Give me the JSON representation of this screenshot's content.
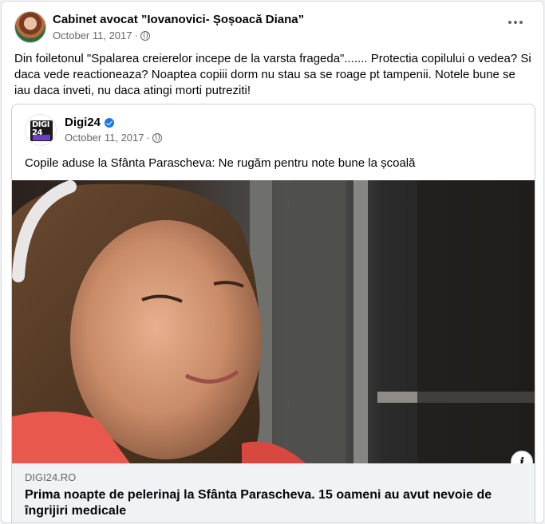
{
  "post": {
    "author": "Cabinet avocat ”Iovanovici- Șoșoacă Diana”",
    "timestamp": "October 11, 2017",
    "separator": "·",
    "privacy_icon": "globe-icon",
    "more_icon": "more-options-icon",
    "text": "Din foiletonul \"Spalarea creierelor incepe de la varsta frageda\"....... Protectia copilului o vedea? Si daca vede reactioneaza? Noaptea copiii dorm nu stau sa se roage pt tampenii. Notele bune se iau daca inveti, nu daca atingi morti putreziti!"
  },
  "shared": {
    "page_name": "Digi24",
    "page_logo_text": "DIGI 24",
    "verified_icon": "verified-badge-icon",
    "timestamp": "October 11, 2017",
    "separator": "·",
    "text": "Copile aduse la Sfânta Parascheva: Ne rugăm pentru note bune la școală",
    "link": {
      "domain": "DIGI24.RO",
      "title": "Prima noapte de pelerinaj la Sfânta Parascheva. 15 oameni au avut nevoie de îngrijiri medicale",
      "info_icon": "info-icon",
      "info_label": "i"
    }
  },
  "colors": {
    "background": "#f0f2f5",
    "card": "#ffffff",
    "secondary_text": "#65676b",
    "verified_blue": "#1877f2"
  }
}
